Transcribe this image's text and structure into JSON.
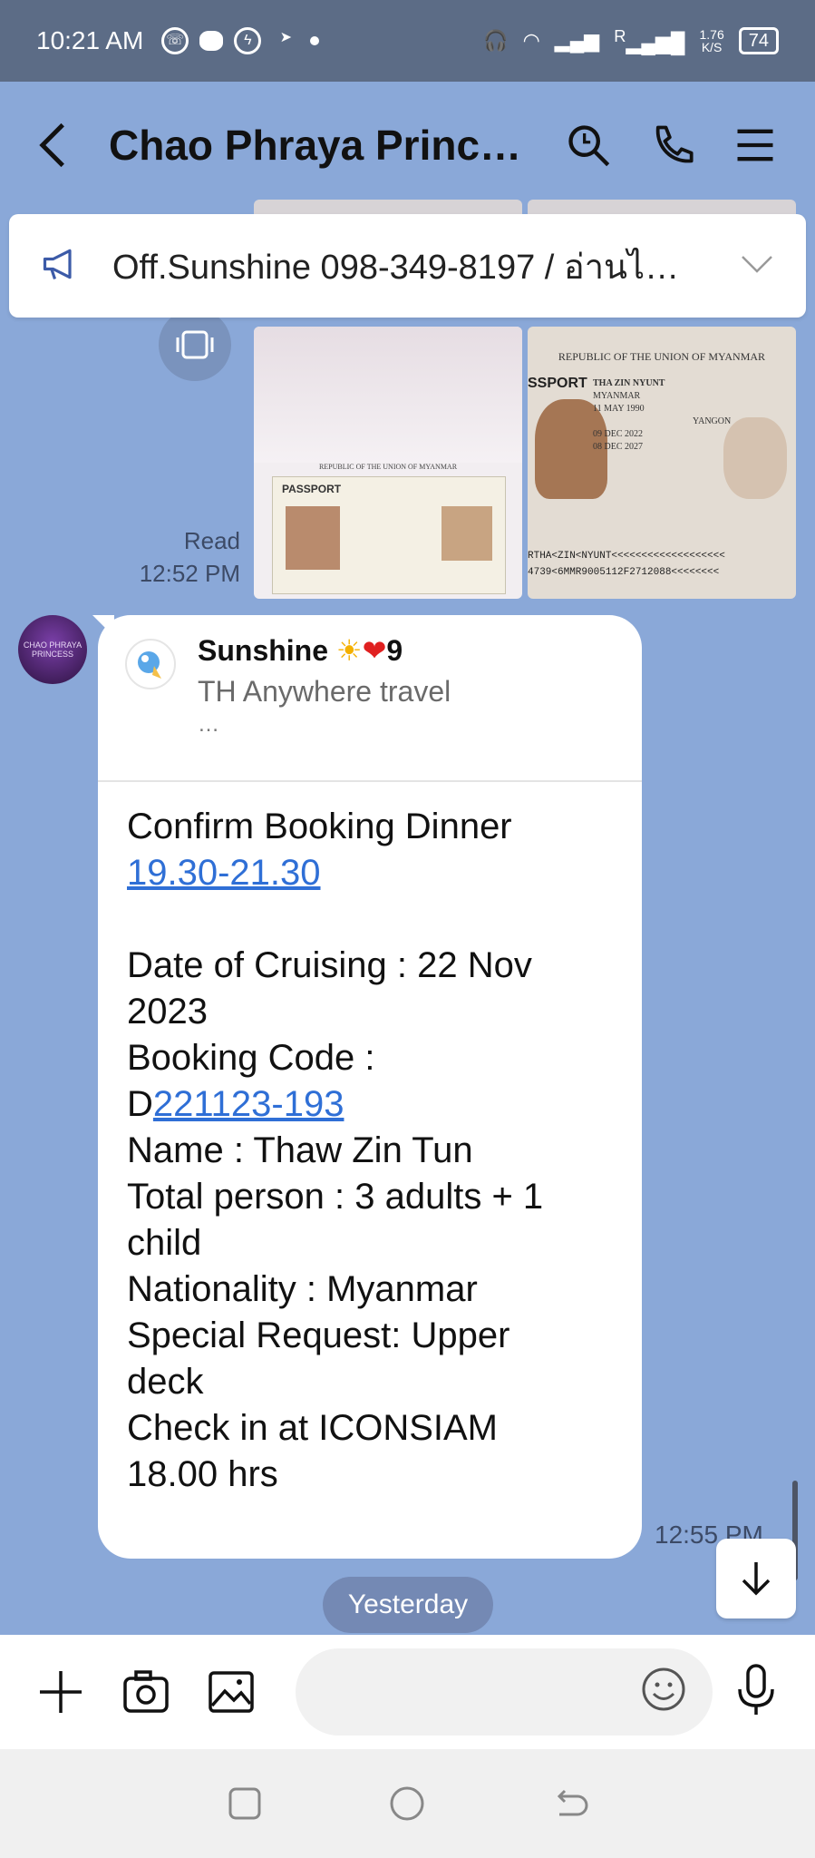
{
  "status_bar": {
    "time": "10:21 AM",
    "net_speed_top": "1.76",
    "net_speed_bottom": "K/S",
    "battery": "74",
    "signal_label": "R"
  },
  "header": {
    "title": "Chao Phraya Princ…"
  },
  "announcement": {
    "text": "Off.Sunshine  098-349-8197 / อ่านไ…"
  },
  "passport_images": {
    "img1_tag": "PASSPORT",
    "img1_header": "REPUBLIC OF THE UNION OF MYANMAR",
    "img2_header": "REPUBLIC OF THE UNION OF MYANMAR",
    "img2_label": "SSPORT",
    "img2_name": "THA ZIN NYUNT",
    "img2_nationality": "MYANMAR",
    "img2_dob": "11 MAY 1990",
    "img2_place": "YANGON",
    "img2_issue": "09 DEC 2022",
    "img2_expiry": "08 DEC 2027",
    "img2_mrz1": "RTHA<ZIN<NYUNT<<<<<<<<<<<<<<<<<<<",
    "img2_mrz2": "4739<6MMR9005112F2712088<<<<<<<<"
  },
  "read_receipt": {
    "status": "Read",
    "time": "12:52 PM"
  },
  "message": {
    "sender_name": "Sunshine",
    "sender_suffix": "9",
    "sender_sub": "TH Anywhere travel",
    "sender_more": "…",
    "line1": "Confirm Booking  Dinner",
    "line1_link": "19.30-21.30",
    "date_line_a": "Date of Cruising : 22 Nov",
    "date_line_b": "2023",
    "booking_code_label": "Booking Code :",
    "booking_code_prefix": "D",
    "booking_code_link": "221123-193",
    "name_line": "Name : Thaw Zin Tun",
    "total_line_a": "Total person : 3 adults + 1",
    "total_line_b": "child",
    "nationality_line": "Nationality : Myanmar",
    "special_line_a": "Special Request: Upper",
    "special_line_b": "deck",
    "checkin_line_a": "Check in at ICONSIAM",
    "checkin_line_b": "18.00 hrs",
    "time": "12:55 PM"
  },
  "date_separator": "Yesterday",
  "composer": {
    "placeholder": ""
  },
  "avatar_text": "CHAO PHRAYA PRINCESS"
}
